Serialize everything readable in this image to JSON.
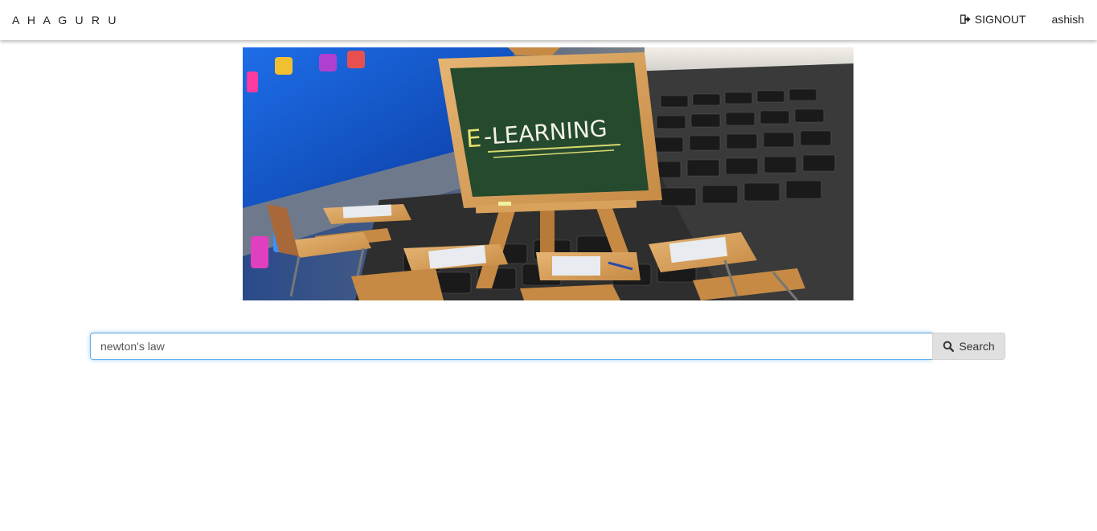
{
  "navbar": {
    "brand": "A H A G U R U",
    "signout_label": "SIGNOUT",
    "username": "ashish"
  },
  "hero": {
    "board_text": "E-LEARNING",
    "icon": "e-learning-banner-image"
  },
  "search": {
    "value": "newton's law",
    "button_label": "Search",
    "icon": "search-icon"
  },
  "colors": {
    "focus_border": "#66afe9",
    "button_bg": "#e0e0e0",
    "chalkboard": "#254a2e"
  }
}
